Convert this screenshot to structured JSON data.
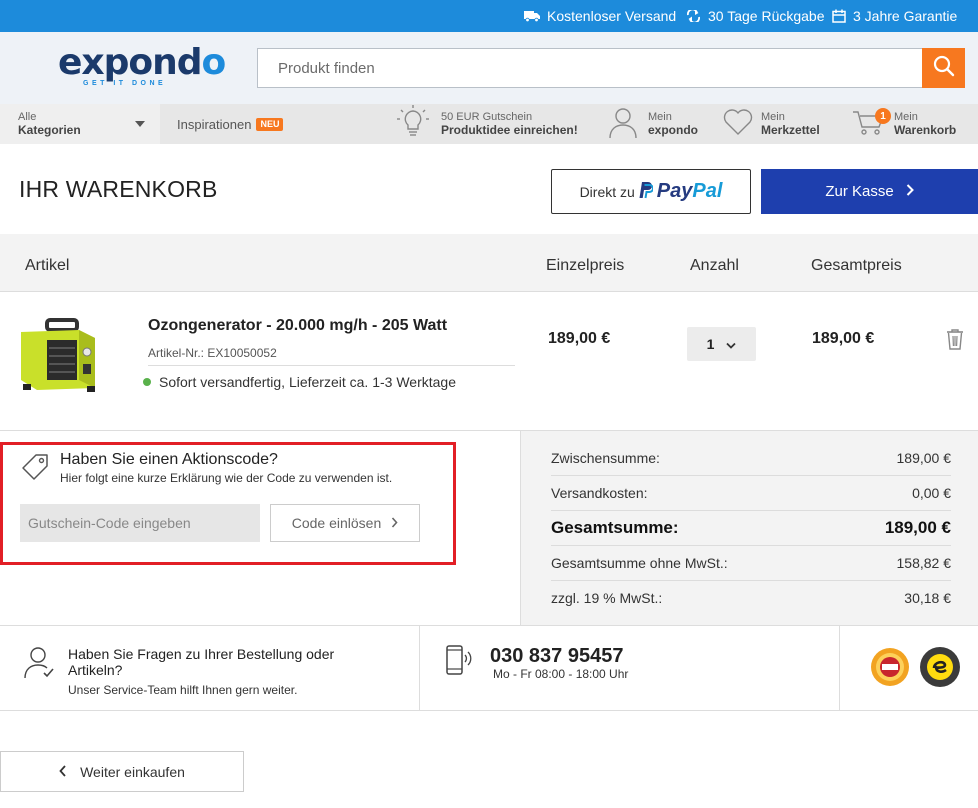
{
  "topbar": {
    "shipping": "Kostenloser Versand",
    "returns": "30 Tage Rückgabe",
    "warranty": "3 Jahre Garantie"
  },
  "header": {
    "logo": {
      "name_part1": "expond",
      "name_part2": "o",
      "tagline": "GET IT DONE"
    },
    "search": {
      "placeholder": "Produkt finden",
      "value": ""
    }
  },
  "nav": {
    "categories": {
      "small": "Alle",
      "bold": "Kategorien"
    },
    "inspirations": {
      "label": "Inspirationen",
      "badge": "NEU"
    },
    "voucher": {
      "small": "50 EUR Gutschein",
      "bold": "Produktidee einreichen!"
    },
    "account": {
      "small": "Mein",
      "bold": "expondo"
    },
    "wishlist": {
      "small": "Mein",
      "bold": "Merkzettel"
    },
    "cart": {
      "small": "Mein",
      "bold": "Warenkorb",
      "count": "1"
    }
  },
  "page": {
    "title": "IHR WARENKORB",
    "paypal": {
      "prefix": "Direkt zu",
      "brand1": "Pay",
      "brand2": "Pal"
    },
    "checkout": "Zur Kasse"
  },
  "table": {
    "headers": {
      "article": "Artikel",
      "unit_price": "Einzelpreis",
      "quantity": "Anzahl",
      "total": "Gesamtpreis"
    },
    "items": [
      {
        "name": "Ozongenerator - 20.000 mg/h - 205 Watt",
        "sku": "Artikel-Nr.: EX10050052",
        "availability": "Sofort versandfertig, Lieferzeit ca. 1-3 Werktage",
        "unit_price": "189,00 €",
        "quantity": "1",
        "total": "189,00 €"
      }
    ]
  },
  "coupon": {
    "title": "Haben Sie einen Aktionscode?",
    "description": "Hier folgt eine kurze Erklärung wie der Code zu verwenden ist.",
    "input_placeholder": "Gutschein-Code eingeben",
    "input_value": "",
    "button": "Code einlösen",
    "highlight_color": "#e21f26"
  },
  "summary": {
    "subtotal_label": "Zwischensumme:",
    "subtotal": "189,00 €",
    "shipping_label": "Versandkosten:",
    "shipping": "0,00 €",
    "grand_total_label": "Gesamtsumme:",
    "grand_total": "189,00 €",
    "net_label": "Gesamtsumme ohne MwSt.:",
    "net": "158,82 €",
    "vat_label": "zzgl. 19 % MwSt.:",
    "vat": "30,18 €"
  },
  "service": {
    "question": "Haben Sie Fragen zu Ihrer Bestellung oder Artikeln?",
    "subtext": "Unser Service-Team hilft Ihnen gern weiter.",
    "phone": "030 837 95457",
    "hours": "Mo - Fr 08:00 - 18:00 Uhr"
  },
  "continue_shopping": "Weiter einkaufen",
  "colors": {
    "topbar": "#1d8bdb",
    "brand_dark": "#1b3a6b",
    "accent_orange": "#f7781f",
    "checkout_blue": "#1e3fae",
    "available_green": "#59b14b"
  }
}
